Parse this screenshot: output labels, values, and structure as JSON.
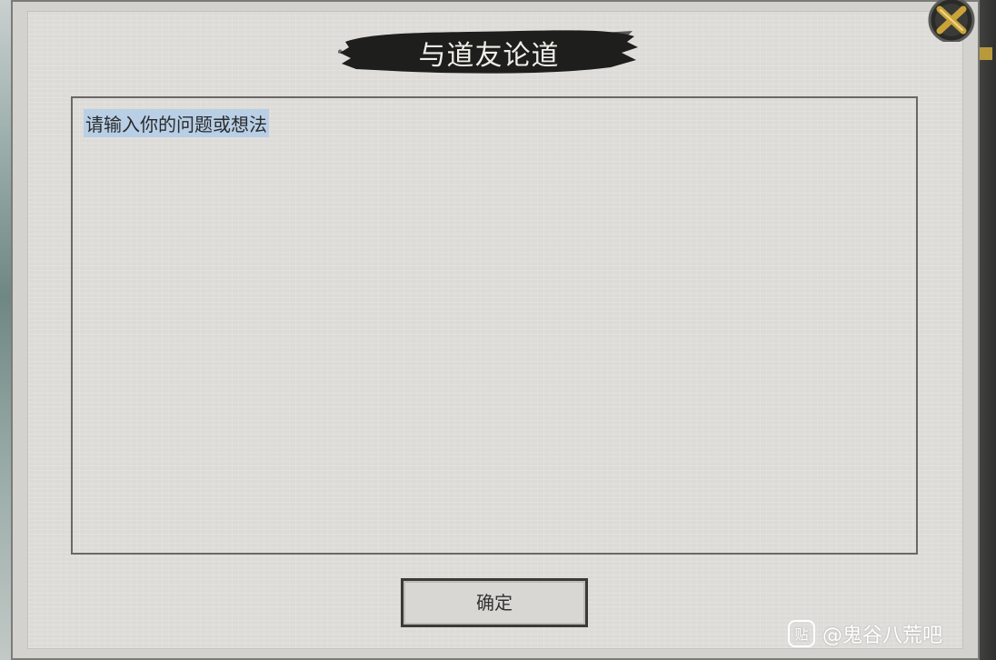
{
  "dialog": {
    "title": "与道友论道",
    "input": {
      "placeholder": "请输入你的问题或想法",
      "value": ""
    },
    "confirm_label": "确定",
    "close_icon": "close-x-icon"
  },
  "watermark": {
    "icon_glyph": "贴",
    "text": "@鬼谷八荒吧"
  },
  "colors": {
    "panel": "#d3d2cf",
    "banner_ink": "#1e1e1c",
    "title_text": "#f1efe9",
    "placeholder_highlight": "#b9cfe6",
    "close_gold": "#c9a33a"
  }
}
